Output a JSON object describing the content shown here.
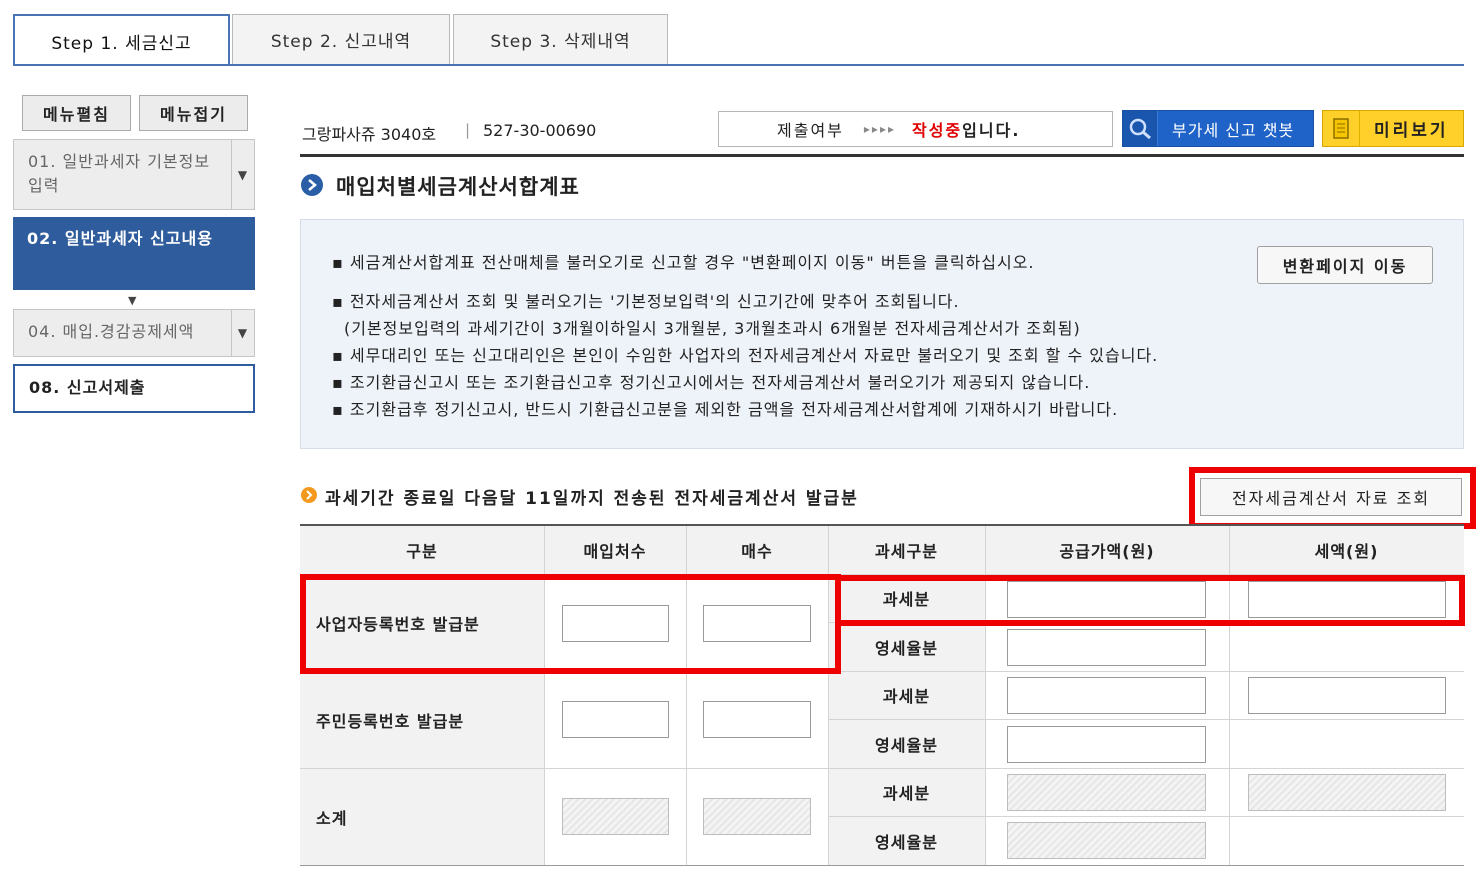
{
  "tabs": [
    {
      "label": "Step  1. 세금신고",
      "active": true
    },
    {
      "label": "Step  2. 신고내역",
      "active": false
    },
    {
      "label": "Step  3. 삭제내역",
      "active": false
    }
  ],
  "sidebar": {
    "expand_label": "메뉴펼침",
    "collapse_label": "메뉴접기",
    "items": [
      {
        "label": "01. 일반과세자 기본정보 입력",
        "state": "collapsed"
      },
      {
        "label": "02. 일반과세자 신고내용",
        "state": "active"
      },
      {
        "label": "04. 매입.경감공제세액",
        "state": "collapsed"
      },
      {
        "label": "08. 신고서제출",
        "state": "normal"
      }
    ]
  },
  "header": {
    "company": "그랑파사쥬 3040호",
    "separator": "|",
    "biz_no": "527-30-00690",
    "status_label": "제출여부",
    "status_arrows": "▸▸▸▸",
    "status_value": "작성중",
    "status_suffix": "입니다.",
    "chatbot_label": "부가세 신고 챗봇",
    "preview_label": "미리보기"
  },
  "section_title": "매입처별세금계산서합계표",
  "notices": [
    "▪ 세금계산서합계표 전산매체를 불러오기로 신고할 경우 \"변환페이지 이동\" 버튼을 클릭하십시오.",
    "▪ 전자세금계산서 조회 및 불러오기는 '기본정보입력'의 신고기간에 맞추어 조회됩니다.",
    "(기본정보입력의 과세기간이 3개월이하일시 3개월분, 3개월초과시 6개월분 전자세금계산서가 조회됨)",
    "▪ 세무대리인 또는 신고대리인은 본인이 수임한 사업자의 전자세금계산서 자료만 불러오기 및 조회 할 수 있습니다.",
    "▪ 조기환급신고시 또는 조기환급신고후 정기신고시에서는 전자세금계산서 불러오기가 제공되지 않습니다.",
    "▪ 조기환급후 정기신고시, 반드시 기환급신고분을 제외한 금액을 전자세금계산서합계에 기재하시기 바랍니다."
  ],
  "convert_button": "변환페이지 이동",
  "subsection_title": "과세기간 종료일 다음달 11일까지 전송된 전자세금계산서 발급분",
  "lookup_button": "전자세금계산서 자료 조회",
  "table": {
    "headers": [
      "구분",
      "매입처수",
      "매수",
      "과세구분",
      "공급가액(원)",
      "세액(원)"
    ],
    "groups": [
      {
        "label": "사업자등록번호 발급분",
        "rows": [
          "과세분",
          "영세율분"
        ]
      },
      {
        "label": "주민등록번호 발급분",
        "rows": [
          "과세분",
          "영세율분"
        ]
      },
      {
        "label": "소계",
        "rows": [
          "과세분",
          "영세율분"
        ]
      }
    ]
  },
  "colors": {
    "accent_blue": "#2f5c9c",
    "status_red": "#e00000",
    "highlight_red": "#ee0000",
    "preview_yellow": "#ffd02a",
    "chatbot_blue": "#1f63c9"
  }
}
